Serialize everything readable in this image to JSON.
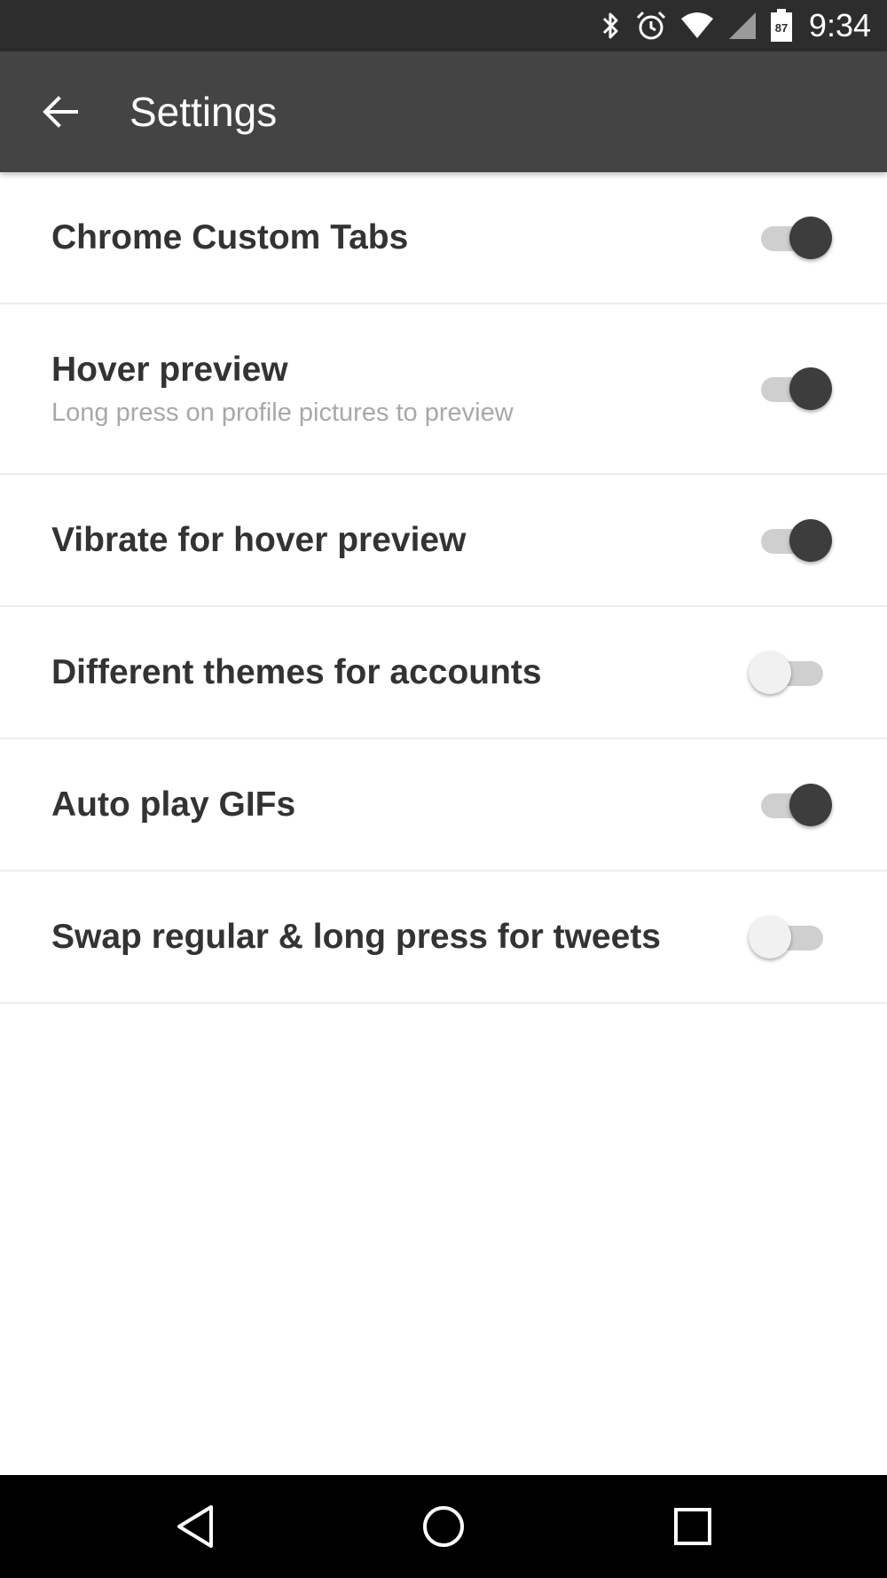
{
  "status_bar": {
    "time": "9:34",
    "battery_level": "87",
    "icons": [
      "bluetooth-icon",
      "alarm-icon",
      "wifi-icon",
      "cell-signal-icon",
      "battery-icon"
    ]
  },
  "app_bar": {
    "title": "Settings",
    "back_icon": "arrow-back-icon"
  },
  "settings": [
    {
      "title": "Chrome Custom Tabs",
      "subtitle": "",
      "enabled": true
    },
    {
      "title": "Hover preview",
      "subtitle": "Long press on profile pictures to preview",
      "enabled": true
    },
    {
      "title": "Vibrate for hover preview",
      "subtitle": "",
      "enabled": true
    },
    {
      "title": "Different themes for accounts",
      "subtitle": "",
      "enabled": false
    },
    {
      "title": "Auto play GIFs",
      "subtitle": "",
      "enabled": true
    },
    {
      "title": "Swap regular & long press for tweets",
      "subtitle": "",
      "enabled": false
    }
  ],
  "nav_bar": {
    "buttons": [
      "nav-back-icon",
      "nav-home-icon",
      "nav-recents-icon"
    ]
  },
  "colors": {
    "status_bar": "#2d2d2d",
    "app_bar": "#444444",
    "toggle_on_thumb": "#3d3d3d",
    "toggle_off_thumb": "#f1f1f1",
    "toggle_track": "#cfcfcf",
    "nav_bar": "#000000"
  }
}
